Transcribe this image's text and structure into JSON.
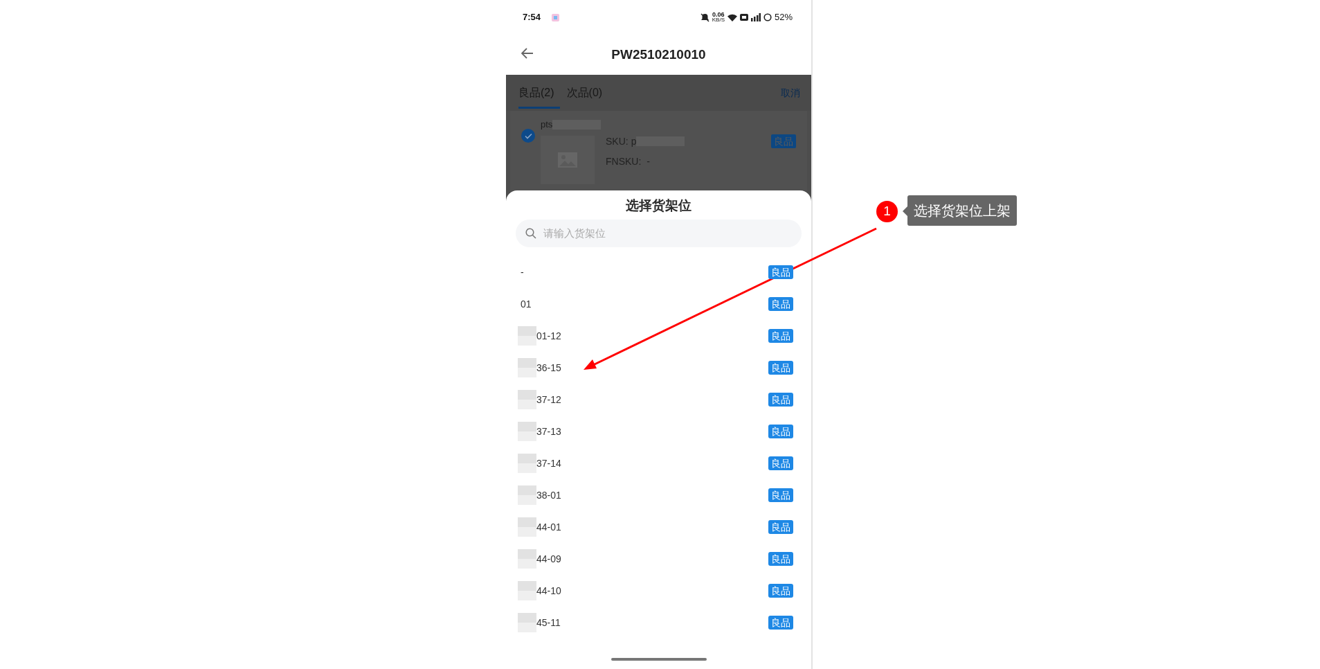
{
  "status_bar": {
    "time": "7:54",
    "net_speed": "0.06",
    "net_unit": "KB/S",
    "battery": "52%"
  },
  "header": {
    "title": "PW2510210010"
  },
  "tabs": [
    {
      "label": "良品(2)",
      "selected": true
    },
    {
      "label": "次品(0)",
      "selected": false
    }
  ],
  "cancel": "取消",
  "items": [
    {
      "name": "pts",
      "checked": true,
      "sku_label": "SKU:",
      "sku_value": "p",
      "fnsku_label": "FNSKU:",
      "fnsku_value": "-",
      "quality": "良品"
    }
  ],
  "sheet": {
    "title": "选择货架位",
    "search": {
      "placeholder": "请输入货架位"
    },
    "locations": [
      {
        "code": "-",
        "quality": "良品",
        "masked": false
      },
      {
        "code": "01",
        "quality": "良品",
        "masked": false
      },
      {
        "code": "01-12",
        "quality": "良品",
        "masked": true
      },
      {
        "code": "36-15",
        "quality": "良品",
        "masked": true
      },
      {
        "code": "37-12",
        "quality": "良品",
        "masked": true
      },
      {
        "code": "37-13",
        "quality": "良品",
        "masked": true
      },
      {
        "code": "37-14",
        "quality": "良品",
        "masked": true
      },
      {
        "code": "38-01",
        "quality": "良品",
        "masked": true
      },
      {
        "code": "44-01",
        "quality": "良品",
        "masked": true
      },
      {
        "code": "44-09",
        "quality": "良品",
        "masked": true
      },
      {
        "code": "44-10",
        "quality": "良品",
        "masked": true
      },
      {
        "code": "45-11",
        "quality": "良品",
        "masked": true
      }
    ]
  },
  "annotation": {
    "number": "1",
    "text": "选择货架位上架"
  }
}
